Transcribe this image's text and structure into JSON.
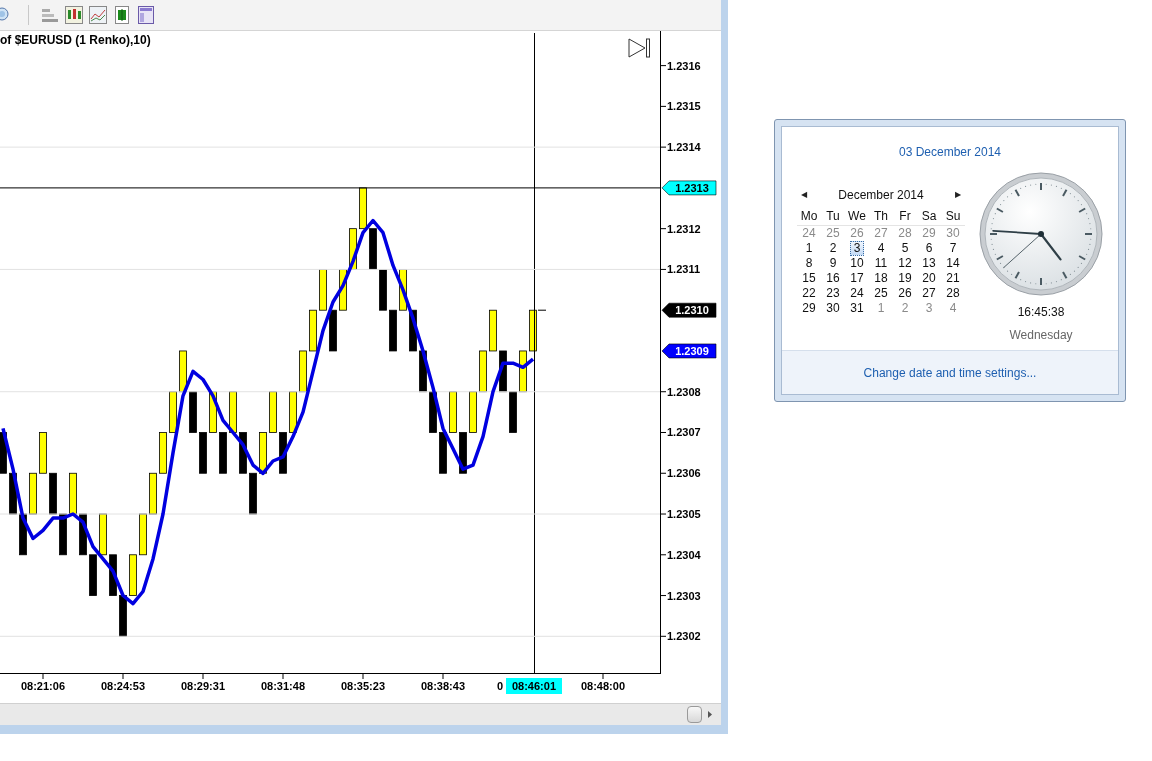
{
  "chart": {
    "title": "of $EURUSD (1 Renko),10)",
    "chart_data": {
      "type": "line",
      "grid": true,
      "ylim": [
        1.23011,
        1.23168
      ],
      "yticks": [
        {
          "value": 1.2316,
          "label": "1.2316"
        },
        {
          "value": 1.2315,
          "label": "1.2315"
        },
        {
          "value": 1.2314,
          "label": "1.2314"
        },
        {
          "value": 1.2312,
          "label": "1.2312"
        },
        {
          "value": 1.2311,
          "label": "1.2311"
        },
        {
          "value": 1.2308,
          "label": "1.2308"
        },
        {
          "value": 1.2307,
          "label": "1.2307"
        },
        {
          "value": 1.2306,
          "label": "1.2306"
        },
        {
          "value": 1.2305,
          "label": "1.2305"
        },
        {
          "value": 1.2304,
          "label": "1.2304"
        },
        {
          "value": 1.2303,
          "label": "1.2303"
        },
        {
          "value": 1.2302,
          "label": "1.2302"
        }
      ],
      "categories": [
        null,
        null,
        null,
        null,
        "08:21:06",
        null,
        null,
        null,
        null,
        null,
        null,
        null,
        "08:24:53",
        null,
        null,
        null,
        null,
        null,
        null,
        null,
        "08:29:31",
        null,
        null,
        null,
        null,
        null,
        null,
        null,
        "08:31:48",
        null,
        null,
        null,
        null,
        null,
        null,
        null,
        "08:35:23",
        null,
        null,
        null,
        null,
        null,
        null,
        null,
        "08:38:43",
        null,
        null,
        null,
        null,
        null,
        null,
        null,
        null,
        null,
        null,
        null,
        null,
        null,
        null,
        null,
        "08:48:00"
      ],
      "series": [
        {
          "color": "#0000e0",
          "values": [
            1.23071,
            1.23061,
            1.23049,
            1.23044,
            1.23046,
            1.23049,
            1.23049,
            1.2305,
            1.23048,
            1.23042,
            1.23039,
            1.23036,
            1.2303,
            1.23028,
            1.23031,
            1.23039,
            1.2305,
            1.23065,
            1.23079,
            1.23085,
            1.23083,
            1.23079,
            1.23073,
            1.2307,
            1.23067,
            1.23062,
            1.2306,
            1.23063,
            1.23064,
            1.23069,
            1.23075,
            1.23085,
            1.23095,
            1.23102,
            1.23106,
            1.23112,
            1.23119,
            1.23122,
            1.23119,
            1.23111,
            1.23105,
            1.23098,
            1.2309,
            1.23081,
            1.23071,
            1.23066,
            1.23061,
            1.23062,
            1.23069,
            1.2308,
            1.23087,
            1.23087,
            1.23086,
            1.23088,
            null,
            null,
            null,
            null,
            null,
            null,
            null
          ]
        }
      ]
    },
    "bricks": [
      {
        "kind": "down"
      },
      {
        "kind": "down"
      },
      {
        "kind": "down"
      },
      {
        "kind": "up"
      },
      {
        "kind": "up"
      },
      {
        "kind": "down"
      },
      {
        "kind": "down"
      },
      {
        "kind": "up"
      },
      {
        "kind": "down"
      },
      {
        "kind": "down"
      },
      {
        "kind": "up"
      },
      {
        "kind": "down"
      },
      {
        "kind": "down"
      },
      {
        "kind": "up"
      },
      {
        "kind": "up"
      },
      {
        "kind": "up"
      },
      {
        "kind": "up"
      },
      {
        "kind": "up"
      },
      {
        "kind": "up"
      },
      {
        "kind": "down"
      },
      {
        "kind": "down"
      },
      {
        "kind": "up"
      },
      {
        "kind": "down"
      },
      {
        "kind": "up"
      },
      {
        "kind": "down"
      },
      {
        "kind": "down"
      },
      {
        "kind": "up"
      },
      {
        "kind": "up"
      },
      {
        "kind": "down"
      },
      {
        "kind": "up"
      },
      {
        "kind": "up"
      },
      {
        "kind": "up"
      },
      {
        "kind": "up"
      },
      {
        "kind": "down"
      },
      {
        "kind": "up"
      },
      {
        "kind": "up"
      },
      {
        "kind": "up"
      },
      {
        "kind": "down"
      },
      {
        "kind": "down"
      },
      {
        "kind": "down"
      },
      {
        "kind": "up"
      },
      {
        "kind": "down"
      },
      {
        "kind": "down"
      },
      {
        "kind": "down"
      },
      {
        "kind": "down"
      },
      {
        "kind": "up"
      },
      {
        "kind": "down"
      },
      {
        "kind": "up"
      },
      {
        "kind": "up"
      },
      {
        "kind": "up"
      },
      {
        "kind": "down"
      },
      {
        "kind": "down"
      },
      {
        "kind": "up"
      },
      {
        "kind": "up"
      }
    ],
    "price_tags": [
      {
        "text": "1.2313",
        "color": "#00ffff"
      },
      {
        "text": "1.2310",
        "color": "#000000"
      },
      {
        "text": "1.2309",
        "color": "#0000ff"
      }
    ],
    "covered_time_label": "0",
    "cursor_time": "08:46:01"
  },
  "calendar": {
    "header": "03 December 2014",
    "month": "December 2014",
    "prev": "◀",
    "next": "▶",
    "weekdays": [
      "Mo",
      "Tu",
      "We",
      "Th",
      "Fr",
      "Sa",
      "Su"
    ],
    "weeks": [
      [
        {
          "day": "24",
          "muted": true,
          "selected": false
        },
        {
          "day": "25",
          "muted": true,
          "selected": false
        },
        {
          "day": "26",
          "muted": true,
          "selected": false
        },
        {
          "day": "27",
          "muted": true,
          "selected": false
        },
        {
          "day": "28",
          "muted": true,
          "selected": false
        },
        {
          "day": "29",
          "muted": true,
          "selected": false
        },
        {
          "day": "30",
          "muted": true,
          "selected": false
        }
      ],
      [
        {
          "day": "1",
          "muted": false,
          "selected": false
        },
        {
          "day": "2",
          "muted": false,
          "selected": false
        },
        {
          "day": "3",
          "muted": false,
          "selected": true
        },
        {
          "day": "4",
          "muted": false,
          "selected": false
        },
        {
          "day": "5",
          "muted": false,
          "selected": false
        },
        {
          "day": "6",
          "muted": false,
          "selected": false
        },
        {
          "day": "7",
          "muted": false,
          "selected": false
        }
      ],
      [
        {
          "day": "8",
          "muted": false,
          "selected": false
        },
        {
          "day": "9",
          "muted": false,
          "selected": false
        },
        {
          "day": "10",
          "muted": false,
          "selected": false
        },
        {
          "day": "11",
          "muted": false,
          "selected": false
        },
        {
          "day": "12",
          "muted": false,
          "selected": false
        },
        {
          "day": "13",
          "muted": false,
          "selected": false
        },
        {
          "day": "14",
          "muted": false,
          "selected": false
        }
      ],
      [
        {
          "day": "15",
          "muted": false,
          "selected": false
        },
        {
          "day": "16",
          "muted": false,
          "selected": false
        },
        {
          "day": "17",
          "muted": false,
          "selected": false
        },
        {
          "day": "18",
          "muted": false,
          "selected": false
        },
        {
          "day": "19",
          "muted": false,
          "selected": false
        },
        {
          "day": "20",
          "muted": false,
          "selected": false
        },
        {
          "day": "21",
          "muted": false,
          "selected": false
        }
      ],
      [
        {
          "day": "22",
          "muted": false,
          "selected": false
        },
        {
          "day": "23",
          "muted": false,
          "selected": false
        },
        {
          "day": "24",
          "muted": false,
          "selected": false
        },
        {
          "day": "25",
          "muted": false,
          "selected": false
        },
        {
          "day": "26",
          "muted": false,
          "selected": false
        },
        {
          "day": "27",
          "muted": false,
          "selected": false
        },
        {
          "day": "28",
          "muted": false,
          "selected": false
        }
      ],
      [
        {
          "day": "29",
          "muted": false,
          "selected": false
        },
        {
          "day": "30",
          "muted": false,
          "selected": false
        },
        {
          "day": "31",
          "muted": false,
          "selected": false
        },
        {
          "day": "1",
          "muted": true,
          "selected": false
        },
        {
          "day": "2",
          "muted": true,
          "selected": false
        },
        {
          "day": "3",
          "muted": true,
          "selected": false
        },
        {
          "day": "4",
          "muted": true,
          "selected": false
        }
      ]
    ],
    "time": "16:45:38",
    "weekday": "Wednesday",
    "settings_link": "Change date and time settings..."
  }
}
